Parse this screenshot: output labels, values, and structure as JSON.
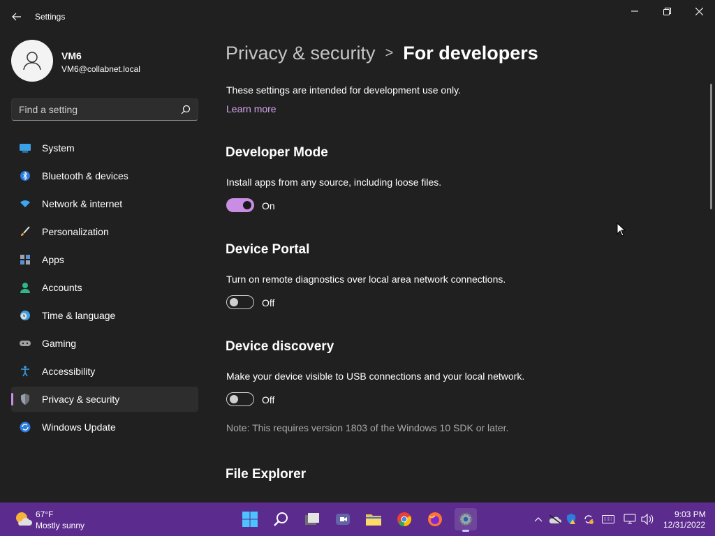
{
  "window": {
    "title": "Settings",
    "minimize_glyph": "–",
    "maximize_glyph": "❐",
    "close_glyph": "✕"
  },
  "profile": {
    "name": "VM6",
    "email": "VM6@collabnet.local"
  },
  "search": {
    "placeholder": "Find a setting"
  },
  "sidebar": {
    "items": [
      {
        "label": "System",
        "icon": "system-icon",
        "active": false
      },
      {
        "label": "Bluetooth & devices",
        "icon": "bluetooth-icon",
        "active": false
      },
      {
        "label": "Network & internet",
        "icon": "wifi-icon",
        "active": false
      },
      {
        "label": "Personalization",
        "icon": "brush-icon",
        "active": false
      },
      {
        "label": "Apps",
        "icon": "apps-icon",
        "active": false
      },
      {
        "label": "Accounts",
        "icon": "accounts-icon",
        "active": false
      },
      {
        "label": "Time & language",
        "icon": "clock-globe-icon",
        "active": false
      },
      {
        "label": "Gaming",
        "icon": "gamepad-icon",
        "active": false
      },
      {
        "label": "Accessibility",
        "icon": "accessibility-icon",
        "active": false
      },
      {
        "label": "Privacy & security",
        "icon": "shield-icon",
        "active": true
      },
      {
        "label": "Windows Update",
        "icon": "update-icon",
        "active": false
      }
    ]
  },
  "breadcrumb": {
    "parent": "Privacy & security",
    "separator": ">",
    "current": "For developers"
  },
  "main": {
    "intro": "These settings are intended for development use only.",
    "learn_more": "Learn more",
    "developer_mode": {
      "title": "Developer Mode",
      "description": "Install apps from any source, including loose files.",
      "state": "On"
    },
    "device_portal": {
      "title": "Device Portal",
      "description": "Turn on remote diagnostics over local area network connections.",
      "state": "Off"
    },
    "device_discovery": {
      "title": "Device discovery",
      "description": "Make your device visible to USB connections and your local network.",
      "state": "Off",
      "note": "Note: This requires version 1803 of the Windows 10 SDK or later."
    },
    "file_explorer": {
      "title": "File Explorer"
    }
  },
  "taskbar": {
    "weather": {
      "temp": "67°F",
      "desc": "Mostly sunny"
    },
    "clock": {
      "time": "9:03 PM",
      "date": "12/31/2022"
    },
    "accent": "#5c2b8e"
  },
  "colors": {
    "accent": "#c98ee3",
    "background": "#202020"
  }
}
